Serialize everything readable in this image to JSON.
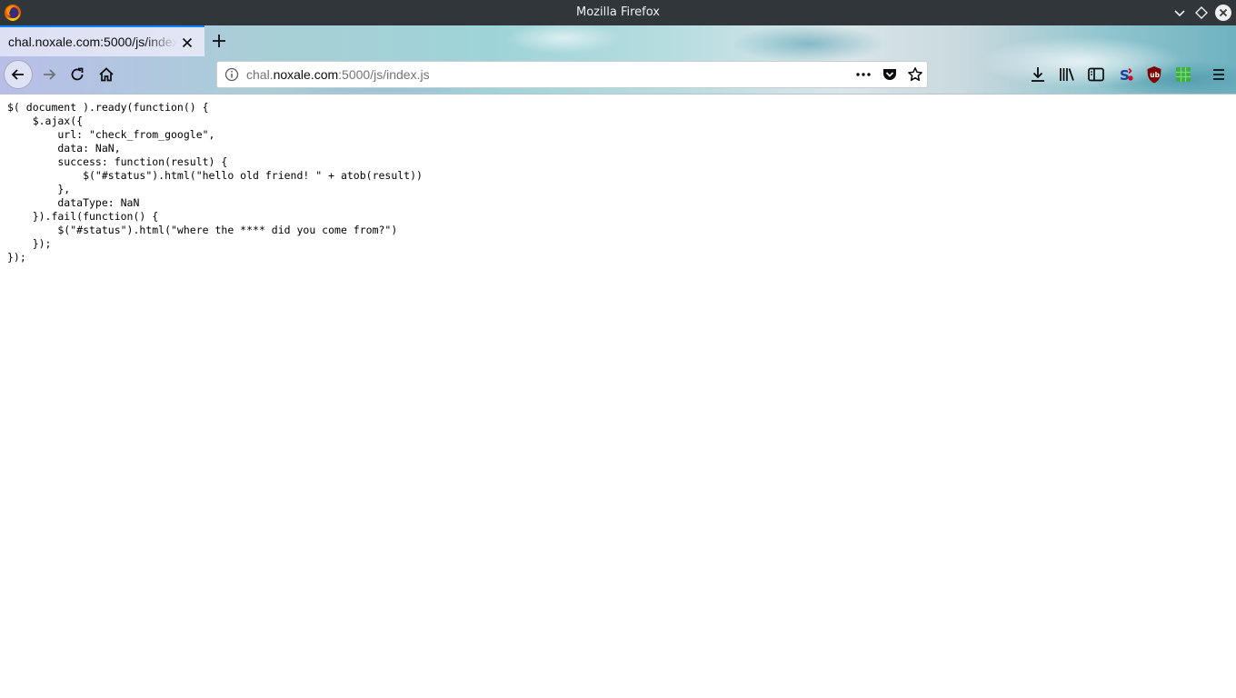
{
  "window": {
    "title": "Mozilla Firefox"
  },
  "tabs": [
    {
      "title": "chal.noxale.com:5000/js/index.js",
      "active": true
    }
  ],
  "urlbar": {
    "url_prefix": "chal.",
    "url_host": "noxale.com",
    "url_path": ":5000/js/index.js"
  },
  "icons": {
    "titlebar": [
      "firefox-logo",
      "minimize-icon",
      "maximize-icon",
      "close-window-icon"
    ],
    "tabs": [
      "tab-close-icon",
      "new-tab-icon"
    ],
    "navigation": [
      "back-arrow-icon",
      "forward-arrow-icon",
      "reload-icon",
      "home-icon"
    ],
    "urlbar": [
      "site-info-icon",
      "page-actions-icon",
      "pocket-icon",
      "bookmark-star-icon"
    ],
    "toolbar_right": [
      "downloads-icon",
      "library-icon",
      "sidebar-icon",
      "extension-s-icon",
      "ublock-origin-icon",
      "extension-green-icon",
      "hamburger-menu-icon"
    ]
  },
  "colors": {
    "titlebar_bg": "#31363b",
    "tab_accent": "#0a84ff",
    "page_bg": "#ffffff"
  },
  "page": {
    "code": "$( document ).ready(function() {\n    $.ajax({\n        url: \"check_from_google\",\n        data: NaN,\n        success: function(result) {\n            $(\"#status\").html(\"hello old friend! \" + atob(result))\n        },\n        dataType: NaN\n    }).fail(function() {\n        $(\"#status\").html(\"where the **** did you come from?\")\n    });\n});"
  }
}
